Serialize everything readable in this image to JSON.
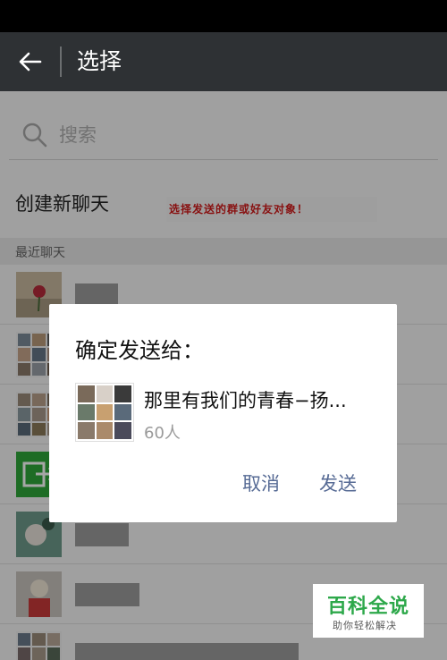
{
  "top_bar": {
    "title": "选择"
  },
  "search": {
    "placeholder": "搜索"
  },
  "new_chat": {
    "label": "创建新聊天"
  },
  "annotation": {
    "text": "选择发送的群或好友对象！"
  },
  "recent": {
    "header": "最近聊天"
  },
  "dialog": {
    "title": "确定发送给：",
    "group_name": "那里有我们的青春−扬...",
    "member_count": "60人",
    "cancel_label": "取消",
    "send_label": "发送"
  },
  "watermark": {
    "main": "百科全说",
    "sub": "助你轻松解决"
  },
  "colors": {
    "top_bar": "#2e3134",
    "link_blue": "#576b95",
    "annotation_red": "#d21b1b",
    "watermark_green": "#2da84a"
  }
}
